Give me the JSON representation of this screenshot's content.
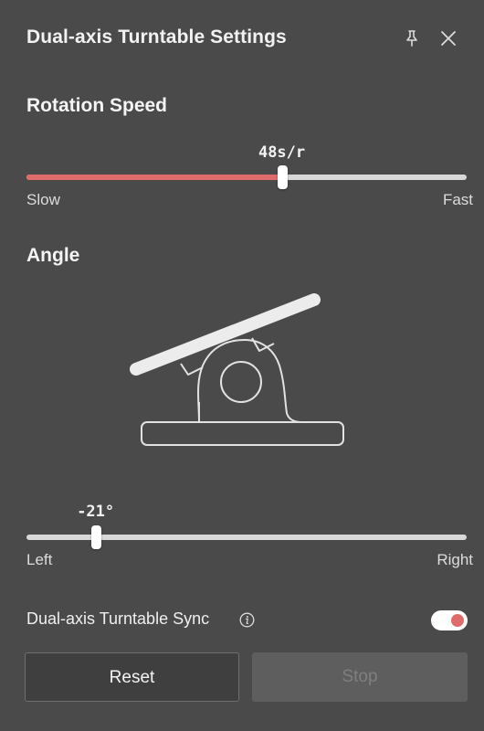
{
  "header": {
    "title": "Dual-axis Turntable Settings",
    "pin_icon": "pin-icon",
    "close_icon": "close-icon"
  },
  "rotation_speed": {
    "label": "Rotation Speed",
    "value_text": "48s/r",
    "fraction": 0.58,
    "min_label": "Slow",
    "max_label": "Fast",
    "fill_color": "#e06b6b"
  },
  "angle": {
    "label": "Angle",
    "value_text": "-21°",
    "value": -21,
    "fraction": 0.157,
    "min_label": "Left",
    "max_label": "Right",
    "illustration_icon": "turntable-tilt-icon"
  },
  "sync": {
    "label": "Dual-axis Turntable Sync",
    "info_icon": "info-icon",
    "enabled": true,
    "accent_color": "#e06b6b"
  },
  "buttons": {
    "reset_label": "Reset",
    "stop_label": "Stop"
  }
}
